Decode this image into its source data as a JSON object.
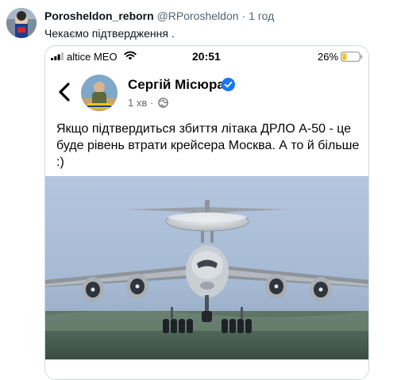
{
  "tweet": {
    "display_name": "Porosheldon_reborn",
    "handle": "@RPorosheldon",
    "separator": "·",
    "age": "1 год",
    "text": "Чекаємо підтвердження ."
  },
  "screenshot": {
    "status_bar": {
      "carrier": "altice MEO",
      "time": "20:51",
      "battery_percent": "26%",
      "battery_level": 0.26
    },
    "post": {
      "author_name": "Сергій Місюра",
      "verified": true,
      "age": "1 хв",
      "separator": "·",
      "text": "Якщо підтвердиться збиття літака ДРЛО А-50 - це буде рівень втрати крейсера Москва. А то й більше :)"
    }
  },
  "colors": {
    "text_primary": "#0f1419",
    "text_secondary": "#536471",
    "verified_blue": "#1877f2",
    "battery_yellow": "#f5c518",
    "sky": "#9fb7d8"
  },
  "icons": [
    "back-arrow-icon",
    "verified-badge-icon",
    "globe-icon",
    "signal-icon",
    "wifi-icon",
    "battery-icon"
  ]
}
